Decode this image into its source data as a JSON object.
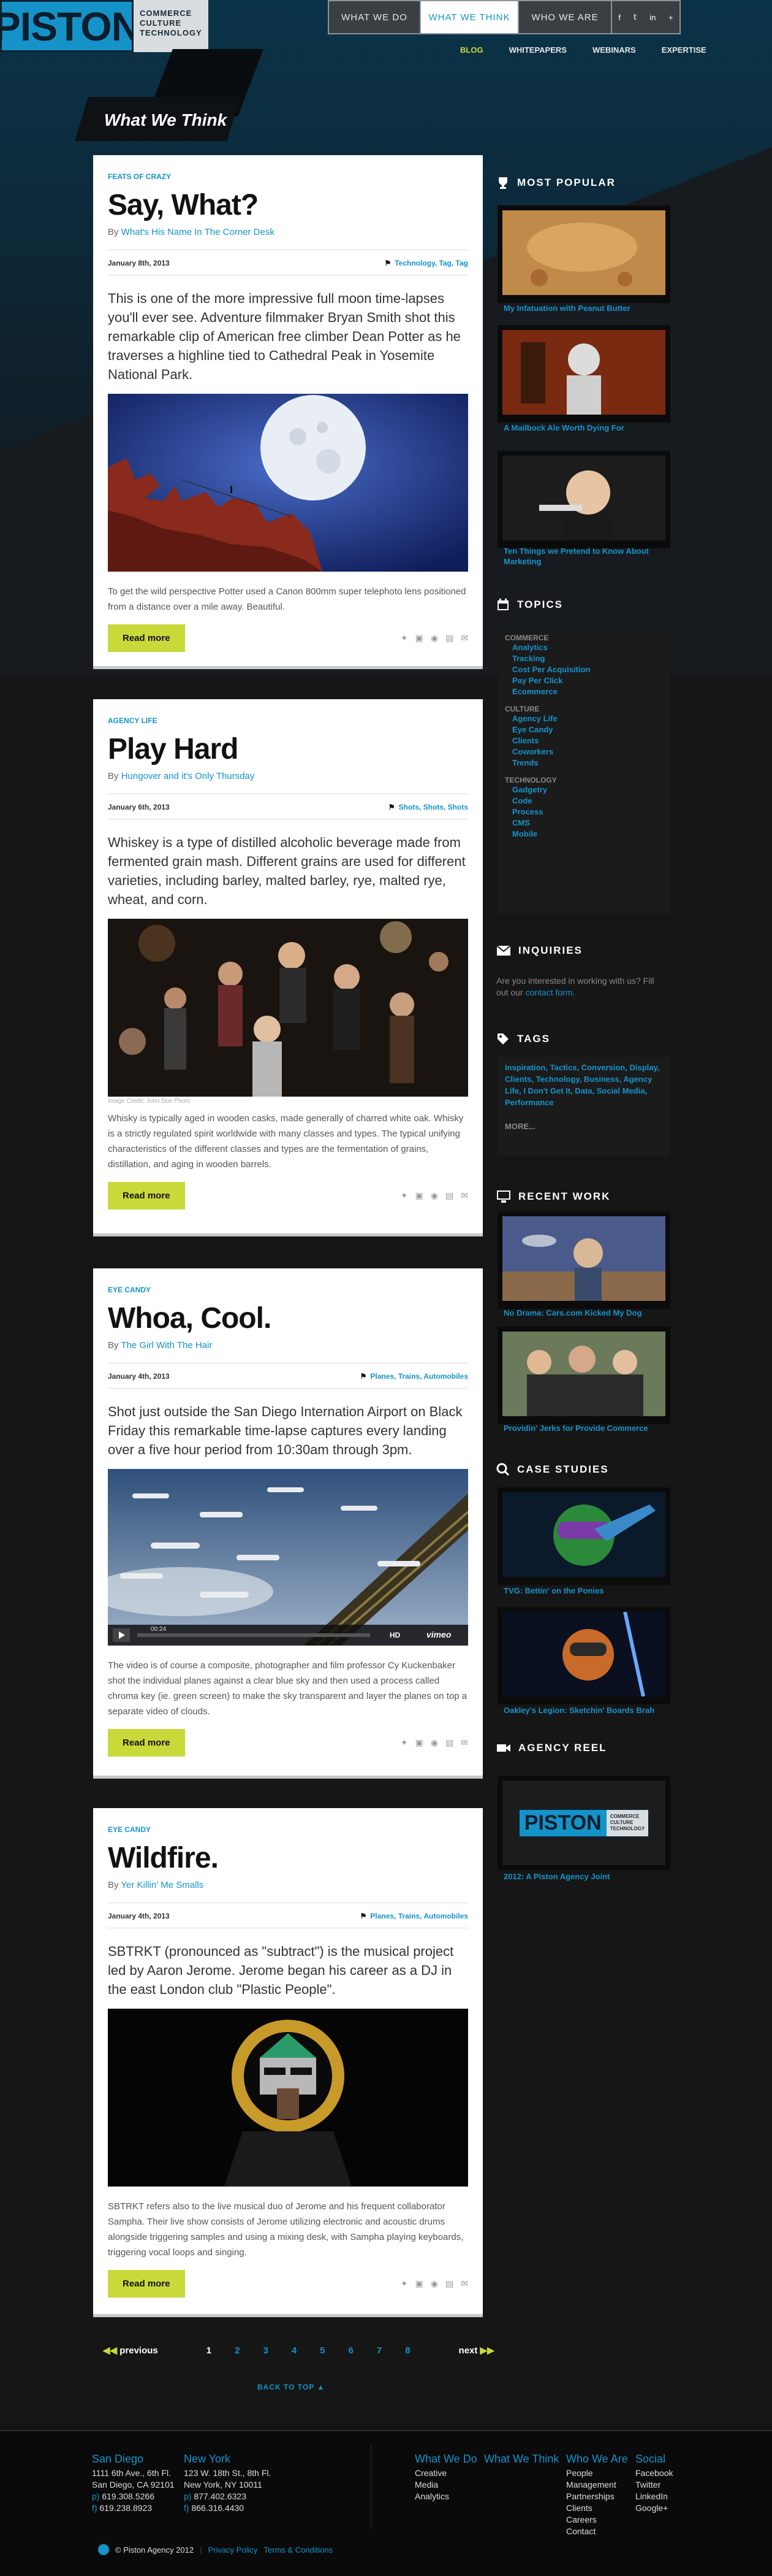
{
  "brand": {
    "logo": "PISTON",
    "tagline": [
      "COMMERCE",
      "CULTURE",
      "TECHNOLOGY"
    ]
  },
  "main_nav": [
    {
      "label": "WHAT WE DO"
    },
    {
      "label": "WHAT WE THINK"
    },
    {
      "label": "WHO WE ARE"
    }
  ],
  "social_glyphs": [
    "f",
    "𝕥",
    "in",
    "+"
  ],
  "sub_nav": [
    {
      "label": "BLOG"
    },
    {
      "label": "WHITEPAPERS"
    },
    {
      "label": "WEBINARS"
    },
    {
      "label": "EXPERTISE"
    }
  ],
  "page_title": "What We Think",
  "articles": [
    {
      "category": "FEATS OF CRAZY",
      "title": "Say, What?",
      "byline_prefix": "By",
      "author": "What's His Name In The Corner Desk",
      "date": "January 8th, 2013",
      "tags": "Technology, Tag, Tag",
      "lede": "This is one of the more impressive full moon time-lapses you'll ever see. Adventure filmmaker Bryan Smith shot this remarkable clip of American free climber Dean Potter as he traverses a highline tied to Cathedral Peak in Yosemite National Park.",
      "caption": "To get the wild perspective Potter used a Canon 800mm super telephoto lens positioned from a distance over a mile away. Beautiful.",
      "read_more": "Read more"
    },
    {
      "category": "AGENCY LIFE",
      "title": "Play Hard",
      "byline_prefix": "By",
      "author": "Hungover and it's Only Thursday",
      "date": "January 6th, 2013",
      "tags": "Shots, Shots, Shots",
      "lede": "Whiskey is a type of distilled alcoholic beverage made from fermented grain mash. Different grains are used for different varieties, including barley, malted barley, rye, malted rye, wheat, and corn.",
      "image_credit": "Image Credit: John Doe Photo",
      "caption": "Whisky is typically aged in wooden casks, made generally of charred white oak. Whisky is a strictly regulated spirit worldwide with many classes and types. The typical unifying characteristics of the different classes and types are the fermentation of grains, distillation, and aging in wooden barrels.",
      "read_more": "Read more"
    },
    {
      "category": "EYE CANDY",
      "title": "Whoa, Cool.",
      "byline_prefix": "By",
      "author": "The Girl With The Hair",
      "date": "January 4th, 2013",
      "tags": "Planes, Trains, Automobiles",
      "lede": "Shot just outside the San Diego Internation Airport on Black Friday this remarkable time-lapse captures every landing over a five hour period from 10:30am through 3pm.",
      "video_time": "00:24",
      "video_brand": "vimeo",
      "video_hd": "HD",
      "caption": "The video is of course a composite, photographer and film professor Cy Kuckenbaker shot the individual planes against a clear blue sky and then used a process called chroma key (ie. green screen) to make the sky transparent and layer the planes on top a separate video of clouds.",
      "read_more": "Read more"
    },
    {
      "category": "EYE CANDY",
      "title": "Wildfire.",
      "byline_prefix": "By",
      "author": "Yer Killin' Me Smalls",
      "date": "January 4th, 2013",
      "tags": "Planes, Trains, Automobiles",
      "lede": "SBTRKT (pronounced as \"subtract\") is the musical project led by Aaron Jerome. Jerome began his career as a DJ in the east London club \"Plastic People\".",
      "caption": "SBTRKT refers also to the live musical duo of Jerome and his frequent collaborator Sampha. Their live show consists of Jerome utilizing electronic and acoustic drums alongside triggering samples and using a mixing desk, with Sampha playing keyboards, triggering vocal loops and singing.",
      "read_more": "Read more"
    }
  ],
  "sidebar": {
    "most_popular": {
      "heading": "MOST POPULAR",
      "items": [
        "My Infatuation with Peanut Butter",
        "A Mailbock Ale Worth Dying For",
        "Ten Things we Pretend to Know About Marketing"
      ]
    },
    "topics": {
      "heading": "TOPICS",
      "groups": [
        {
          "name": "COMMERCE",
          "items": [
            "Analytics",
            "Tracking",
            "Cost Per Acquisition",
            "Pay Per Click",
            "Ecommerce"
          ]
        },
        {
          "name": "CULTURE",
          "items": [
            "Agency Life",
            "Eye Candy",
            "Clients",
            "Coworkers",
            "Trends"
          ]
        },
        {
          "name": "TECHNOLOGY",
          "items": [
            "Gadgetry",
            "Code",
            "Process",
            "CMS",
            "Mobile"
          ]
        }
      ]
    },
    "inquiries": {
      "heading": "INQUIRIES",
      "text": "Are you interested in working with us? Fill out our",
      "link": "contact form."
    },
    "tags": {
      "heading": "TAGS",
      "text": "Inspiration, Tactics, Conversion, Display, Clients, Technology, Business, Agency Life, I Don't Get It, Data, Social Media, Performance",
      "more": "MORE..."
    },
    "recent_work": {
      "heading": "RECENT WORK",
      "items": [
        "No Drama: Cars.com Kicked My Dog",
        "Providin' Jerks for Provide Commerce"
      ]
    },
    "case_studies": {
      "heading": "CASE STUDIES",
      "items": [
        "TVG: Bettin' on the Ponies",
        "Oakley's Legion: Sketchin' Boards Brah"
      ]
    },
    "agency_reel": {
      "heading": "AGENCY REEL",
      "item": "2012: A Piston Agency Joint"
    }
  },
  "pagination": {
    "previous": "previous",
    "next": "next",
    "pages": [
      "1",
      "2",
      "3",
      "4",
      "5",
      "6",
      "7",
      "8"
    ],
    "current": "1"
  },
  "back_to_top": "BACK TO TOP",
  "footer": {
    "offices": [
      {
        "city": "San Diego",
        "address": [
          "1111 6th Ave., 6th Fl.",
          "San Diego, CA 92101"
        ],
        "phone": "619.308.5266",
        "fax": "619.238.8923"
      },
      {
        "city": "New York",
        "address": [
          "123 W. 18th St., 8th Fl.",
          "New York, NY 10011"
        ],
        "phone": "877.402.6323",
        "fax": "866.316.4430"
      }
    ],
    "phone_mark": "p)",
    "fax_mark": "f)",
    "link_columns": [
      {
        "heading": "What We Do",
        "links": [
          "Creative",
          "Media",
          "Analytics"
        ]
      },
      {
        "heading": "What We Think",
        "links": []
      },
      {
        "heading": "Who We Are",
        "links": [
          "People",
          "Management",
          "Partnerships",
          "Clients",
          "Careers",
          "Contact"
        ]
      },
      {
        "heading": "Social",
        "links": [
          "Facebook",
          "Twitter",
          "LinkedIn",
          "Google+"
        ]
      }
    ],
    "copyright": "© Piston Agency 2012",
    "privacy": "Privacy Policy",
    "terms": "Terms & Conditions"
  },
  "colors": {
    "accent": "#1593c9",
    "button": "#c8d93a",
    "background": "#141414"
  }
}
